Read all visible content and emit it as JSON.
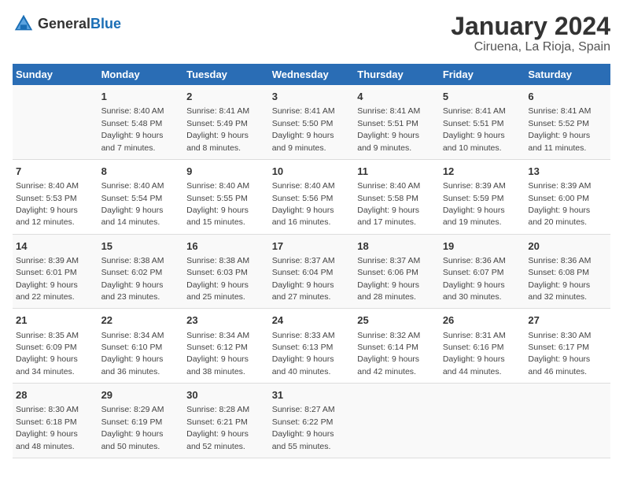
{
  "header": {
    "logo_general": "General",
    "logo_blue": "Blue",
    "main_title": "January 2024",
    "subtitle": "Ciruena, La Rioja, Spain"
  },
  "weekdays": [
    "Sunday",
    "Monday",
    "Tuesday",
    "Wednesday",
    "Thursday",
    "Friday",
    "Saturday"
  ],
  "weeks": [
    [
      {
        "day": "",
        "info": ""
      },
      {
        "day": "1",
        "info": "Sunrise: 8:40 AM\nSunset: 5:48 PM\nDaylight: 9 hours\nand 7 minutes."
      },
      {
        "day": "2",
        "info": "Sunrise: 8:41 AM\nSunset: 5:49 PM\nDaylight: 9 hours\nand 8 minutes."
      },
      {
        "day": "3",
        "info": "Sunrise: 8:41 AM\nSunset: 5:50 PM\nDaylight: 9 hours\nand 9 minutes."
      },
      {
        "day": "4",
        "info": "Sunrise: 8:41 AM\nSunset: 5:51 PM\nDaylight: 9 hours\nand 9 minutes."
      },
      {
        "day": "5",
        "info": "Sunrise: 8:41 AM\nSunset: 5:51 PM\nDaylight: 9 hours\nand 10 minutes."
      },
      {
        "day": "6",
        "info": "Sunrise: 8:41 AM\nSunset: 5:52 PM\nDaylight: 9 hours\nand 11 minutes."
      }
    ],
    [
      {
        "day": "7",
        "info": "Sunrise: 8:40 AM\nSunset: 5:53 PM\nDaylight: 9 hours\nand 12 minutes."
      },
      {
        "day": "8",
        "info": "Sunrise: 8:40 AM\nSunset: 5:54 PM\nDaylight: 9 hours\nand 14 minutes."
      },
      {
        "day": "9",
        "info": "Sunrise: 8:40 AM\nSunset: 5:55 PM\nDaylight: 9 hours\nand 15 minutes."
      },
      {
        "day": "10",
        "info": "Sunrise: 8:40 AM\nSunset: 5:56 PM\nDaylight: 9 hours\nand 16 minutes."
      },
      {
        "day": "11",
        "info": "Sunrise: 8:40 AM\nSunset: 5:58 PM\nDaylight: 9 hours\nand 17 minutes."
      },
      {
        "day": "12",
        "info": "Sunrise: 8:39 AM\nSunset: 5:59 PM\nDaylight: 9 hours\nand 19 minutes."
      },
      {
        "day": "13",
        "info": "Sunrise: 8:39 AM\nSunset: 6:00 PM\nDaylight: 9 hours\nand 20 minutes."
      }
    ],
    [
      {
        "day": "14",
        "info": "Sunrise: 8:39 AM\nSunset: 6:01 PM\nDaylight: 9 hours\nand 22 minutes."
      },
      {
        "day": "15",
        "info": "Sunrise: 8:38 AM\nSunset: 6:02 PM\nDaylight: 9 hours\nand 23 minutes."
      },
      {
        "day": "16",
        "info": "Sunrise: 8:38 AM\nSunset: 6:03 PM\nDaylight: 9 hours\nand 25 minutes."
      },
      {
        "day": "17",
        "info": "Sunrise: 8:37 AM\nSunset: 6:04 PM\nDaylight: 9 hours\nand 27 minutes."
      },
      {
        "day": "18",
        "info": "Sunrise: 8:37 AM\nSunset: 6:06 PM\nDaylight: 9 hours\nand 28 minutes."
      },
      {
        "day": "19",
        "info": "Sunrise: 8:36 AM\nSunset: 6:07 PM\nDaylight: 9 hours\nand 30 minutes."
      },
      {
        "day": "20",
        "info": "Sunrise: 8:36 AM\nSunset: 6:08 PM\nDaylight: 9 hours\nand 32 minutes."
      }
    ],
    [
      {
        "day": "21",
        "info": "Sunrise: 8:35 AM\nSunset: 6:09 PM\nDaylight: 9 hours\nand 34 minutes."
      },
      {
        "day": "22",
        "info": "Sunrise: 8:34 AM\nSunset: 6:10 PM\nDaylight: 9 hours\nand 36 minutes."
      },
      {
        "day": "23",
        "info": "Sunrise: 8:34 AM\nSunset: 6:12 PM\nDaylight: 9 hours\nand 38 minutes."
      },
      {
        "day": "24",
        "info": "Sunrise: 8:33 AM\nSunset: 6:13 PM\nDaylight: 9 hours\nand 40 minutes."
      },
      {
        "day": "25",
        "info": "Sunrise: 8:32 AM\nSunset: 6:14 PM\nDaylight: 9 hours\nand 42 minutes."
      },
      {
        "day": "26",
        "info": "Sunrise: 8:31 AM\nSunset: 6:16 PM\nDaylight: 9 hours\nand 44 minutes."
      },
      {
        "day": "27",
        "info": "Sunrise: 8:30 AM\nSunset: 6:17 PM\nDaylight: 9 hours\nand 46 minutes."
      }
    ],
    [
      {
        "day": "28",
        "info": "Sunrise: 8:30 AM\nSunset: 6:18 PM\nDaylight: 9 hours\nand 48 minutes."
      },
      {
        "day": "29",
        "info": "Sunrise: 8:29 AM\nSunset: 6:19 PM\nDaylight: 9 hours\nand 50 minutes."
      },
      {
        "day": "30",
        "info": "Sunrise: 8:28 AM\nSunset: 6:21 PM\nDaylight: 9 hours\nand 52 minutes."
      },
      {
        "day": "31",
        "info": "Sunrise: 8:27 AM\nSunset: 6:22 PM\nDaylight: 9 hours\nand 55 minutes."
      },
      {
        "day": "",
        "info": ""
      },
      {
        "day": "",
        "info": ""
      },
      {
        "day": "",
        "info": ""
      }
    ]
  ]
}
